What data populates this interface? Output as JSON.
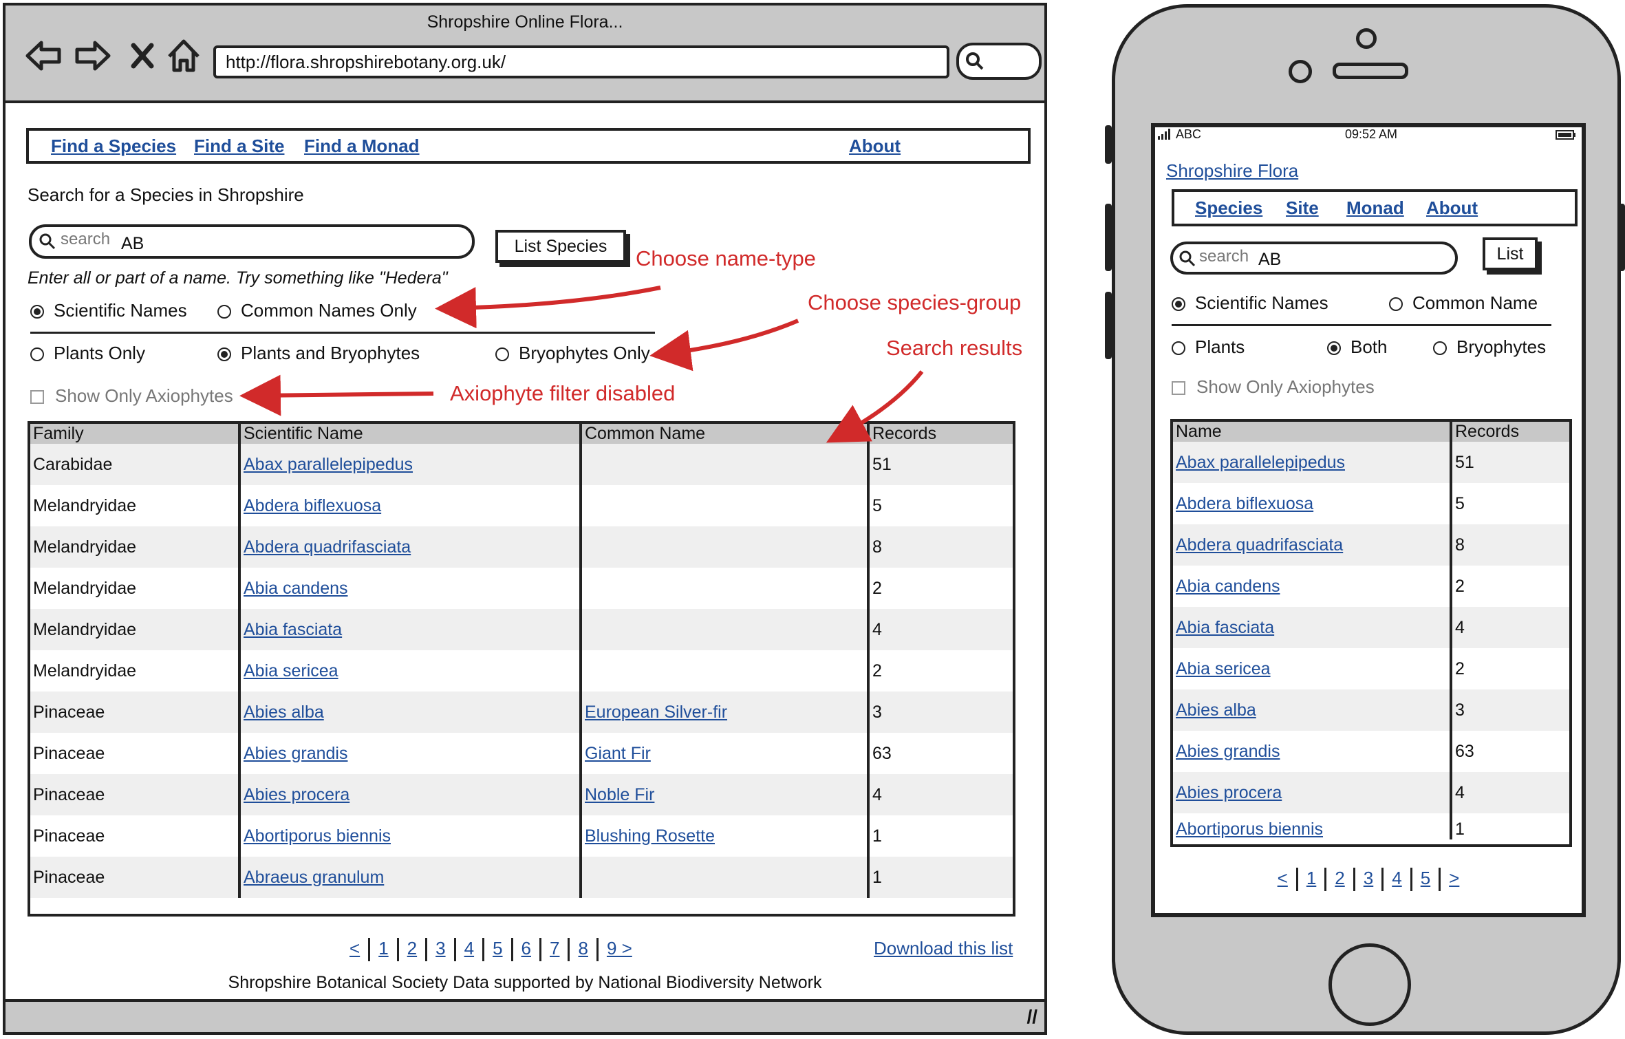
{
  "browser": {
    "window_title": "Shropshire Online Flora...",
    "url": "http://flora.shropshirebotany.org.uk/",
    "nav_icons": [
      "back-icon",
      "forward-icon",
      "stop-icon",
      "home-icon"
    ],
    "nav": [
      "Find a Species",
      "Find a Site",
      "Find a Monad"
    ],
    "nav_about": "About",
    "heading": "Search for a Species in Shropshire",
    "search": {
      "placeholder": "search",
      "value": "AB"
    },
    "list_button": "List Species",
    "hint": "Enter all or part of a name.  Try something like \"Hedera\"",
    "name_type": {
      "options": [
        "Scientific Names",
        "Common Names Only"
      ],
      "selected": 0
    },
    "species_group": {
      "options": [
        "Plants Only",
        "Plants and Bryophytes",
        "Bryophytes Only"
      ],
      "selected": 1
    },
    "axiophytes": {
      "label": "Show Only Axiophytes",
      "checked": false,
      "disabled": true
    },
    "table": {
      "headers": [
        "Family",
        "Scientific Name",
        "Common Name",
        "Records"
      ],
      "rows": [
        {
          "family": "Carabidae",
          "scientific": "Abax parallelepipedus",
          "common": "",
          "records": "51"
        },
        {
          "family": "Melandryidae",
          "scientific": "Abdera biflexuosa",
          "common": "",
          "records": "5"
        },
        {
          "family": "Melandryidae",
          "scientific": "Abdera quadrifasciata",
          "common": "",
          "records": "8"
        },
        {
          "family": "Melandryidae",
          "scientific": "Abia candens",
          "common": "",
          "records": "2"
        },
        {
          "family": "Melandryidae",
          "scientific": "Abia fasciata",
          "common": "",
          "records": "4"
        },
        {
          "family": "Melandryidae",
          "scientific": "Abia sericea",
          "common": "",
          "records": "2"
        },
        {
          "family": "Pinaceae",
          "scientific": "Abies alba",
          "common": "European Silver-fir",
          "records": "3"
        },
        {
          "family": "Pinaceae",
          "scientific": "Abies grandis",
          "common": "Giant Fir",
          "records": "63"
        },
        {
          "family": "Pinaceae",
          "scientific": "Abies procera",
          "common": "Noble Fir",
          "records": "4"
        },
        {
          "family": "Pinaceae",
          "scientific": "Abortiporus biennis",
          "common": "Blushing Rosette",
          "records": "1"
        },
        {
          "family": "Pinaceae",
          "scientific": "Abraeus granulum",
          "common": "",
          "records": "1"
        }
      ]
    },
    "pager": [
      "<",
      "1",
      "2",
      "3",
      "4",
      "5",
      "6",
      "7",
      "8",
      "9 >"
    ],
    "download": "Download this list",
    "footer": "Shropshire Botanical Society Data supported by National Biodiversity Network"
  },
  "annotations": {
    "name_type": "Choose name-type",
    "species_group": "Choose species-group",
    "search_results": "Search results",
    "axiophyte": "Axiophyte filter disabled"
  },
  "annotation_color": "#d12a2a",
  "mobile": {
    "status": {
      "carrier": "ABC",
      "time": "09:52 AM"
    },
    "title": "Shropshire Flora",
    "nav": [
      "Species",
      "Site",
      "Monad",
      "About"
    ],
    "search": {
      "placeholder": "search",
      "value": "AB"
    },
    "list_button": "List",
    "name_type": {
      "options": [
        "Scientific Names",
        "Common Name"
      ],
      "selected": 0
    },
    "species_group": {
      "options": [
        "Plants",
        "Both",
        "Bryophytes"
      ],
      "selected": 1
    },
    "axiophytes": {
      "label": "Show Only Axiophytes",
      "checked": false,
      "disabled": true
    },
    "table": {
      "headers": [
        "Name",
        "Records"
      ],
      "rows": [
        {
          "name": "Abax parallelepipedus",
          "records": "51"
        },
        {
          "name": "Abdera biflexuosa",
          "records": "5"
        },
        {
          "name": "Abdera quadrifasciata",
          "records": "8"
        },
        {
          "name": "Abia candens",
          "records": "2"
        },
        {
          "name": "Abia fasciata",
          "records": "4"
        },
        {
          "name": "Abia sericea",
          "records": "2"
        },
        {
          "name": "Abies alba",
          "records": "3"
        },
        {
          "name": "Abies grandis",
          "records": "63"
        },
        {
          "name": "Abies procera",
          "records": "4"
        },
        {
          "name": "Abortiporus biennis",
          "records": "1"
        }
      ]
    },
    "pager": [
      "<",
      "1",
      "2",
      "3",
      "4",
      "5",
      ">"
    ]
  }
}
